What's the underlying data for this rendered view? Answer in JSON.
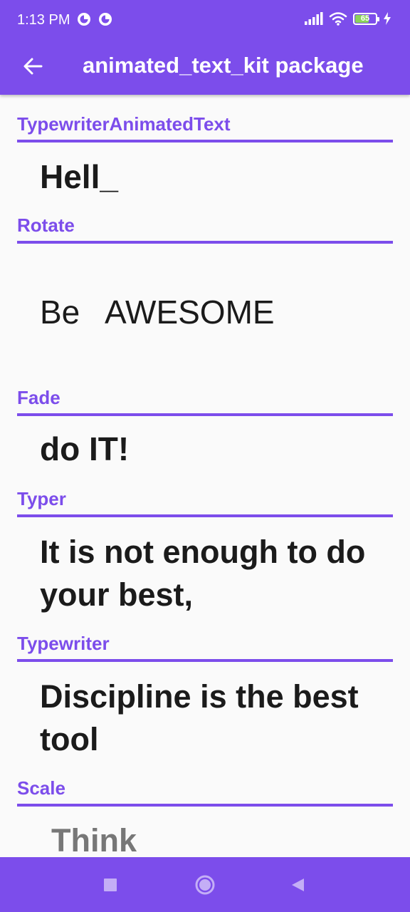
{
  "status_bar": {
    "time": "1:13 PM",
    "battery_level": "65"
  },
  "app_bar": {
    "title": "animated_text_kit package",
    "back_icon": "arrow-left-icon"
  },
  "sections": [
    {
      "label": "TypewriterAnimatedText",
      "text": "Hell_"
    },
    {
      "label": "Rotate",
      "text_prefix": "Be",
      "text_rotating": "AWESOME"
    },
    {
      "label": "Fade",
      "text": "do IT!"
    },
    {
      "label": "Typer",
      "text_line1": "It is not enough to do",
      "text_line2": "your best,"
    },
    {
      "label": "Typewriter",
      "text_line1": "Discipline is the best",
      "text_line2": "tool"
    },
    {
      "label": "Scale",
      "text": "Think"
    }
  ],
  "nav_bar": {
    "recents_icon": "square-icon",
    "home_icon": "circle-icon",
    "back_icon": "triangle-back-icon"
  },
  "colors": {
    "accent": "#7C4DEB",
    "text": "#1B1B1B",
    "background": "#FAFAFA"
  }
}
